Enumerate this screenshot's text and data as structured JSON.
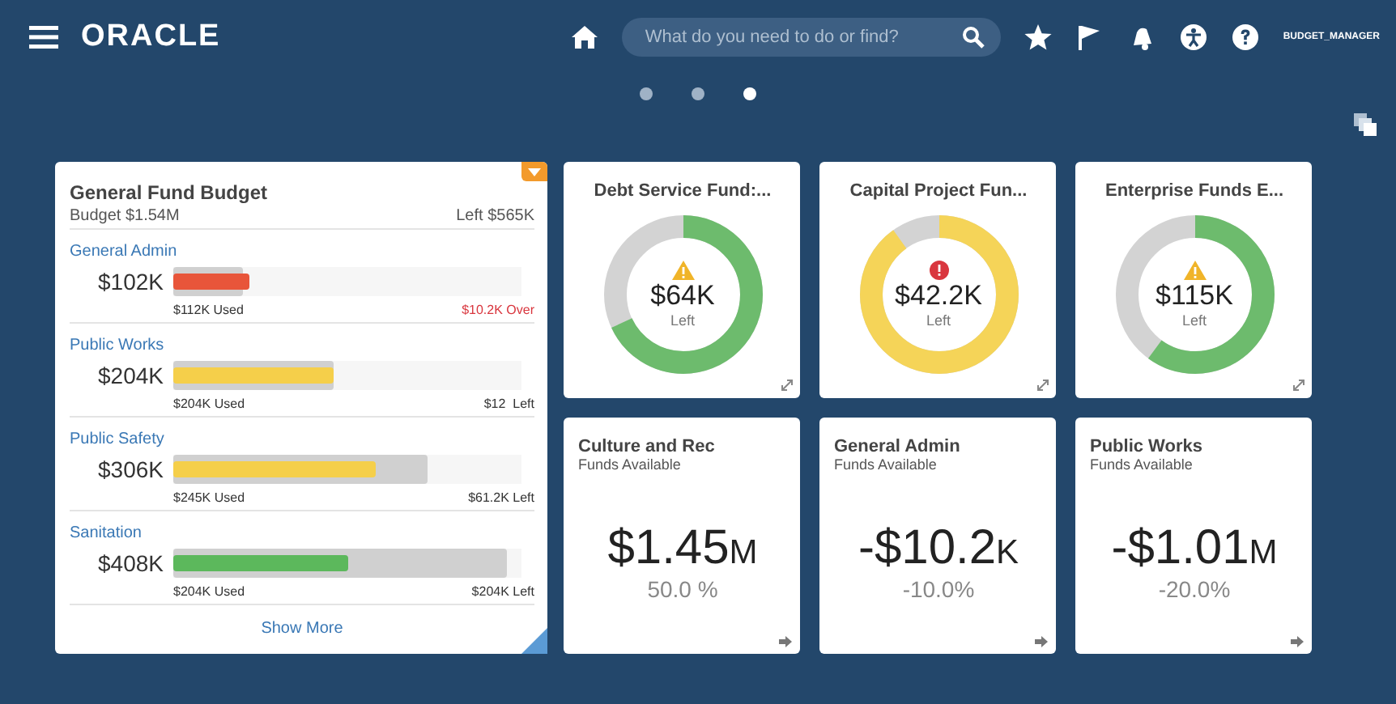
{
  "header": {
    "logo": "ORACLE",
    "search": {
      "placeholder": "What do you need to do or find?"
    },
    "user": "BUDGET_MANAGER"
  },
  "pager": [
    {
      "selected": false
    },
    {
      "selected": false
    },
    {
      "selected": true
    }
  ],
  "budget_card": {
    "title": "General Fund Budget",
    "budget": "Budget $1.54M",
    "left": "Left $565K",
    "show_more": "Show More",
    "rows": [
      {
        "name": "General Admin",
        "amount": "$102K",
        "used": "$112K Used",
        "remaining": "$10.2K Over",
        "kind": "over",
        "color": "#e8553a",
        "budget_bar": {
          "level": 0.2
        },
        "used_bar": {
          "level": 0.22
        }
      },
      {
        "name": "Public Works",
        "amount": "$204K",
        "used": "$204K Used",
        "remaining": "$12  Left",
        "kind": "left",
        "color": "#f5cf4a",
        "budget_bar": {
          "level": 0.46
        },
        "used_bar": {
          "level": 0.46
        }
      },
      {
        "name": "Public Safety",
        "amount": "$306K",
        "used": "$245K Used",
        "remaining": "$61.2K Left",
        "kind": "left",
        "color": "#f5cf4a",
        "budget_bar": {
          "level": 0.73
        },
        "used_bar": {
          "level": 0.58
        }
      },
      {
        "name": "Sanitation",
        "amount": "$408K",
        "used": "$204K Used",
        "remaining": "$204K Left",
        "kind": "left",
        "color": "#5cb85c",
        "budget_bar": {
          "level": 0.96
        },
        "used_bar": {
          "level": 0.5
        }
      }
    ]
  },
  "donut_cards": [
    {
      "title": "Debt Service Fund:...",
      "value": "$64K",
      "caption": "Left",
      "kind": "warning",
      "color": "#6dbb6d",
      "level": 0.68
    },
    {
      "title": "Capital Project Fun...",
      "value": "$42.2K",
      "caption": "Left",
      "kind": "error",
      "color": "#f5d458",
      "level": 0.9
    },
    {
      "title": "Enterprise Funds E...",
      "value": "$115K",
      "caption": "Left",
      "kind": "warning",
      "color": "#6dbb6d",
      "level": 0.6
    }
  ],
  "fund_cards": [
    {
      "title": "Culture and Rec",
      "subtitle": "Funds Available",
      "amount": "$1.45",
      "unit": "M",
      "percent": "50.0 %"
    },
    {
      "title": "General Admin",
      "subtitle": "Funds Available",
      "amount": "-$10.2",
      "unit": "K",
      "percent": "-10.0%"
    },
    {
      "title": "Public Works",
      "subtitle": "Funds Available",
      "amount": "-$1.01",
      "unit": "M",
      "percent": "-20.0%"
    }
  ]
}
